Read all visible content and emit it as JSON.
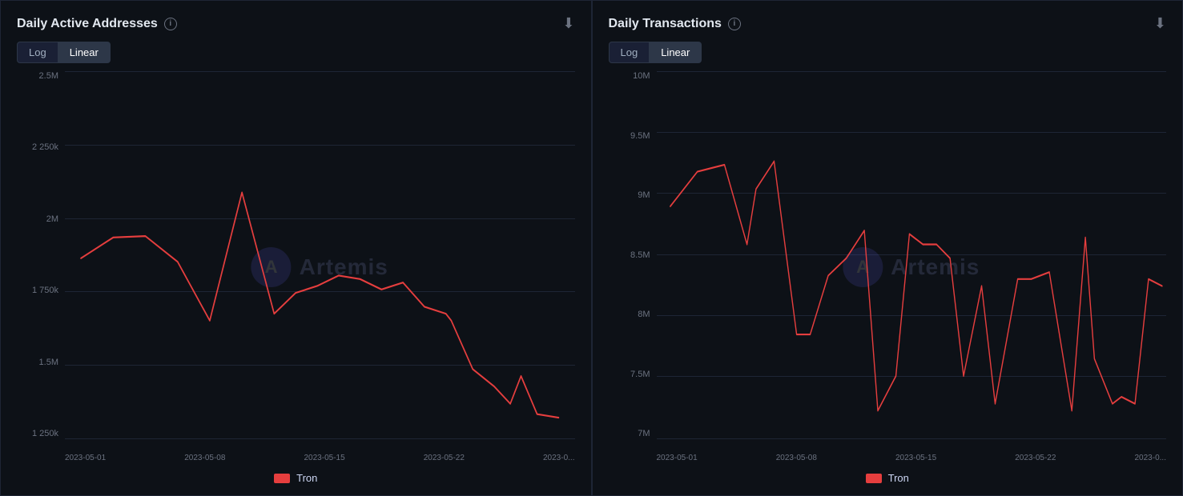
{
  "charts": [
    {
      "id": "daily-active-addresses",
      "title": "Daily Active Addresses",
      "download_icon": "⬇",
      "info_icon": "i",
      "toggle": {
        "options": [
          "Log",
          "Linear"
        ],
        "active": "Linear"
      },
      "y_axis": {
        "labels": [
          "2.5M",
          "2 250k",
          "2M",
          "1 750k",
          "1.5M",
          "1 250k"
        ]
      },
      "x_axis": {
        "labels": [
          "2023-05-01",
          "2023-05-08",
          "2023-05-15",
          "2023-05-22",
          "2023-0..."
        ]
      },
      "watermark_text": "Artemis",
      "legend": [
        {
          "color": "#e53e3e",
          "label": "Tron"
        }
      ],
      "line_points": "30,270 90,240 150,238 210,275 270,360 330,175 390,350 430,320 470,310 510,295 550,300 590,315 630,305 670,340 710,350 720,360 760,430 800,455 830,480 850,440 880,495 920,500"
    },
    {
      "id": "daily-transactions",
      "title": "Daily Transactions",
      "download_icon": "⬇",
      "info_icon": "i",
      "toggle": {
        "options": [
          "Log",
          "Linear"
        ],
        "active": "Linear"
      },
      "y_axis": {
        "labels": [
          "10M",
          "9.5M",
          "9M",
          "8.5M",
          "8M",
          "7.5M",
          "7M"
        ]
      },
      "x_axis": {
        "labels": [
          "2023-05-01",
          "2023-05-08",
          "2023-05-15",
          "2023-05-22",
          "2023-0..."
        ]
      },
      "watermark_text": "Artemis",
      "legend": [
        {
          "color": "#e53e3e",
          "label": "Tron"
        }
      ],
      "line_points": "30,195 90,145 150,135 200,250 220,170 260,130 310,380 340,380 380,295 420,270 460,230 490,490 530,440 560,235 590,250 620,250 650,270 680,440 720,310 750,480 800,300 830,300 870,290 920,490 950,240 970,415 1010,480 1030,470 1060,480 1090,300 1120,310"
    }
  ]
}
